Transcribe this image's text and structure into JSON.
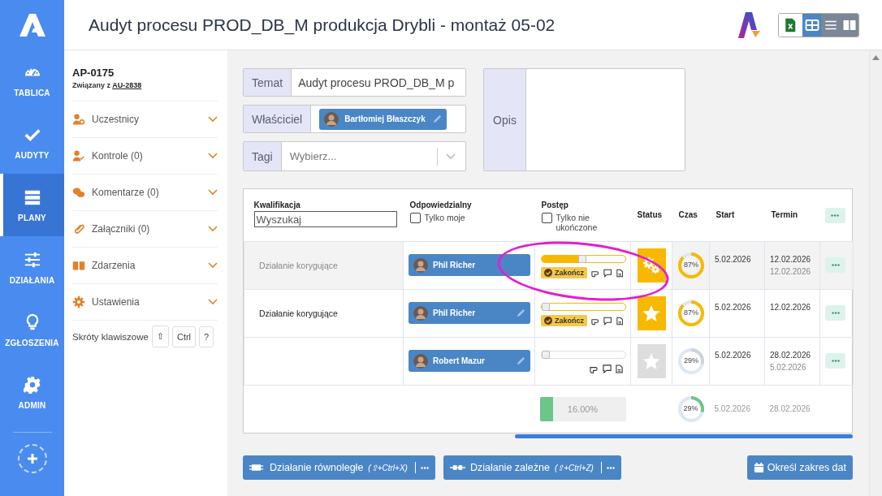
{
  "nav": {
    "items": [
      {
        "label": "TABLICA",
        "kind": "gauge",
        "selected": false
      },
      {
        "label": "AUDYTY",
        "kind": "check",
        "selected": false
      },
      {
        "label": "PLANY",
        "kind": "stack",
        "selected": true
      },
      {
        "label": "DZIAŁANIA",
        "kind": "sliders",
        "selected": false
      },
      {
        "label": "ZGŁOSZENIA",
        "kind": "bulb",
        "selected": false
      },
      {
        "label": "ADMIN",
        "kind": "gear",
        "selected": false
      }
    ]
  },
  "header": {
    "title": "Audyt procesu PROD_DB_M produkcja Drybli - montaż 05-02",
    "views": [
      {
        "kind": "excel",
        "selected": false
      },
      {
        "kind": "table",
        "selected": true
      },
      {
        "kind": "list",
        "selected": false
      },
      {
        "kind": "book",
        "selected": false
      }
    ]
  },
  "side": {
    "code": "AP-0175",
    "related_prefix": "Związany z",
    "related_link": "AU-2838",
    "sections": [
      {
        "label": "Uczestnicy",
        "kind": "users"
      },
      {
        "label": "Kontrole (0)",
        "kind": "usercheck"
      },
      {
        "label": "Komentarze (0)",
        "kind": "comments"
      },
      {
        "label": "Załączniki (0)",
        "kind": "clip"
      },
      {
        "label": "Zdarzenia",
        "kind": "book"
      },
      {
        "label": "Ustawienia",
        "kind": "gear"
      }
    ],
    "shortcuts_label": "Skróty klawiszowe",
    "keys": [
      "⇧",
      "Ctrl",
      "?"
    ]
  },
  "form": {
    "topic_label": "Temat",
    "topic_value": "Audyt procesu PROD_DB_M p",
    "owner_label": "Właściciel",
    "owner": "Bartłomiej Błaszczyk",
    "tags_label": "Tagi",
    "tags_placeholder": "Wybierz...",
    "description_label": "Opis"
  },
  "table": {
    "columns": [
      "Kwalifikacja",
      "Odpowiedzialny",
      "Postęp",
      "Status",
      "Czas",
      "Start",
      "Termin"
    ],
    "search_placeholder": "Wyszukaj",
    "filters": [
      {
        "label": "Tylko moje",
        "checked": false
      },
      {
        "label": "Tylko nie ukończone",
        "checked": false
      }
    ],
    "rows": [
      {
        "qualification": "Działanie korygujące",
        "selected": true,
        "person": "Phil Richer",
        "editable": false,
        "level": 0.48,
        "finish": "Zakończ",
        "status": {
          "kind": "gears",
          "color": "#f9b800"
        },
        "time": {
          "text": "87%",
          "color": "#f9b800"
        },
        "start": "5.02.2026",
        "term": "12.02.2026",
        "term_secondary": "12.02.2026"
      },
      {
        "qualification": "Działanie korygujące",
        "selected": false,
        "person": "Phil Richer",
        "editable": true,
        "level": 0.0,
        "finish": "Zakończ",
        "status": {
          "kind": "star",
          "color": "#f9b800"
        },
        "time": {
          "text": "87%",
          "color": "#f9b800"
        },
        "start": "5.02.2026",
        "term": "12.02.2026"
      },
      {
        "selected": false,
        "person": "Robert Mazur",
        "editable": true,
        "level": 0.0,
        "status": {
          "kind": "star",
          "color": "#dddddd"
        },
        "time": {
          "text": "29%",
          "color": "#cfd3d8"
        },
        "start": "5.02.2026",
        "term": "28.02.2026",
        "term_secondary": "5.02.2026"
      }
    ],
    "summary": {
      "level": 0.16,
      "progress": "16.00%",
      "time": {
        "text": "29%",
        "color": "#6cc68a"
      },
      "start": "5.02.2026",
      "term": "28.02.2026"
    }
  },
  "annotation": {
    "kind": "ellipse",
    "color": "#e21fd0"
  },
  "buttons": [
    {
      "kind": "parallel",
      "label": "Działanie równoległe",
      "shortcut": "(⇧+Ctrl+X)",
      "menu": true
    },
    {
      "kind": "dependent",
      "label": "Działanie zależne",
      "shortcut": "(⇧+Ctrl+Z)",
      "menu": true
    },
    {
      "kind": "calendar",
      "label": "Określ zakres dat",
      "menu": false
    }
  ]
}
